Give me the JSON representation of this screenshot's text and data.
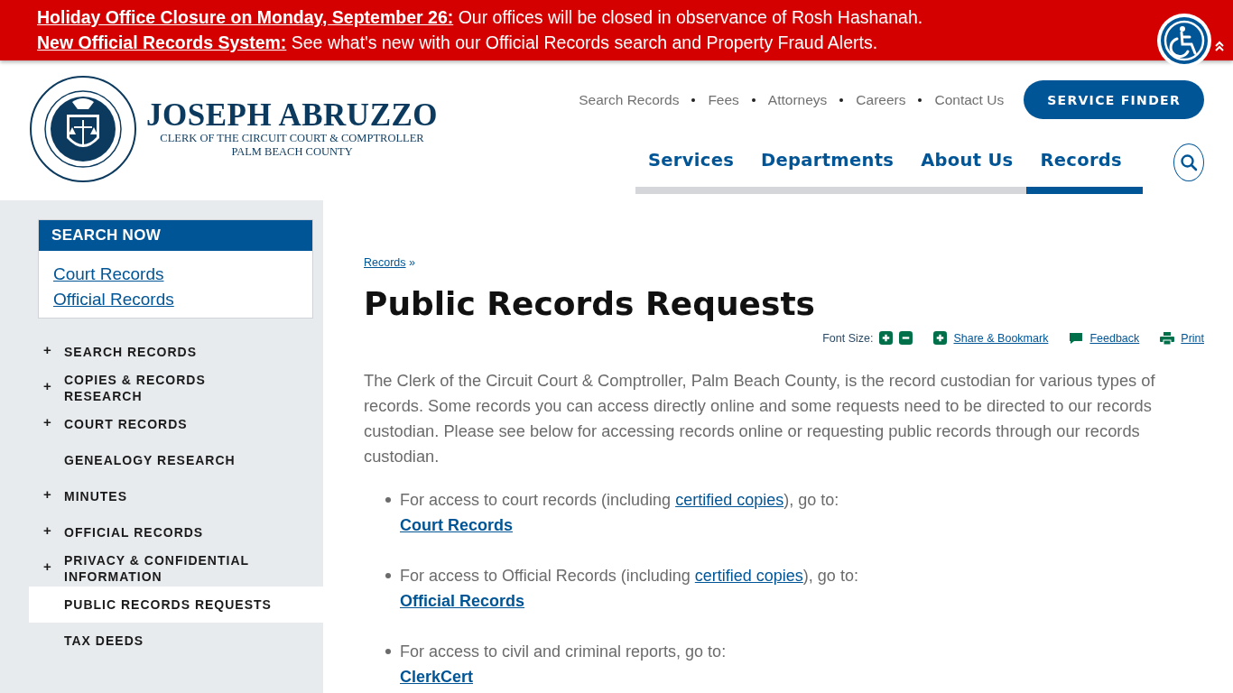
{
  "alerts": [
    {
      "link": "Holiday Office Closure on Monday, September 26:",
      "text": "Our offices will be closed in observance of Rosh Hashanah."
    },
    {
      "link": "New Official Records System:",
      "text": "See what's new with our Official Records search and Property Fraud Alerts."
    }
  ],
  "logo": {
    "name": "JOSEPH ABRUZZO",
    "line1": "CLERK OF THE CIRCUIT COURT & COMPTROLLER",
    "line2": "PALM BEACH COUNTY"
  },
  "utility_nav": [
    "Search Records",
    "Fees",
    "Attorneys",
    "Careers",
    "Contact Us"
  ],
  "service_finder": "SERVICE FINDER",
  "main_nav": [
    {
      "label": "Services",
      "selected": false
    },
    {
      "label": "Departments",
      "selected": false
    },
    {
      "label": "About Us",
      "selected": false
    },
    {
      "label": "Records",
      "selected": true
    }
  ],
  "search_now": {
    "title": "SEARCH NOW",
    "links": [
      "Court Records",
      "Official Records"
    ]
  },
  "sidebar_menu": [
    {
      "label": "SEARCH RECORDS",
      "expandable": true,
      "selected": false,
      "toggle": "+"
    },
    {
      "label": "COPIES & RECORDS RESEARCH",
      "expandable": true,
      "selected": false,
      "toggle": "+"
    },
    {
      "label": "COURT RECORDS",
      "expandable": true,
      "selected": false,
      "toggle": "+"
    },
    {
      "label": "GENEALOGY RESEARCH",
      "expandable": false,
      "selected": false
    },
    {
      "label": "MINUTES",
      "expandable": true,
      "selected": false,
      "toggle": "+"
    },
    {
      "label": "OFFICIAL RECORDS",
      "expandable": true,
      "selected": false,
      "toggle": "+"
    },
    {
      "label": "PRIVACY & CONFIDENTIAL INFORMATION",
      "expandable": true,
      "selected": false,
      "toggle": "+"
    },
    {
      "label": "PUBLIC RECORDS REQUESTS",
      "expandable": false,
      "selected": true
    },
    {
      "label": "TAX DEEDS",
      "expandable": false,
      "selected": false
    }
  ],
  "breadcrumb": {
    "link": "Records",
    "separator": "»"
  },
  "title": "Public Records Requests",
  "tools": {
    "font_size": "Font Size:",
    "share": "Share & Bookmark",
    "feedback": "Feedback",
    "print": "Print"
  },
  "intro": "The Clerk of the Circuit Court & Comptroller, Palm Beach County, is the record custodian for various types of records. Some records you can access directly online and some requests need to be directed to our records custodian. Please see below for accessing records online or requesting public records through our records custodian.",
  "items": [
    {
      "before": "For access to court records (including ",
      "link": "certified copies",
      "after": "), go to:",
      "target": "Court Records"
    },
    {
      "before": "For access to Official Records (including ",
      "link": "certified copies",
      "after": "), go to:",
      "target": "Official Records"
    },
    {
      "before": "For access to civil and criminal reports, go to:",
      "target": "ClerkCert"
    }
  ]
}
